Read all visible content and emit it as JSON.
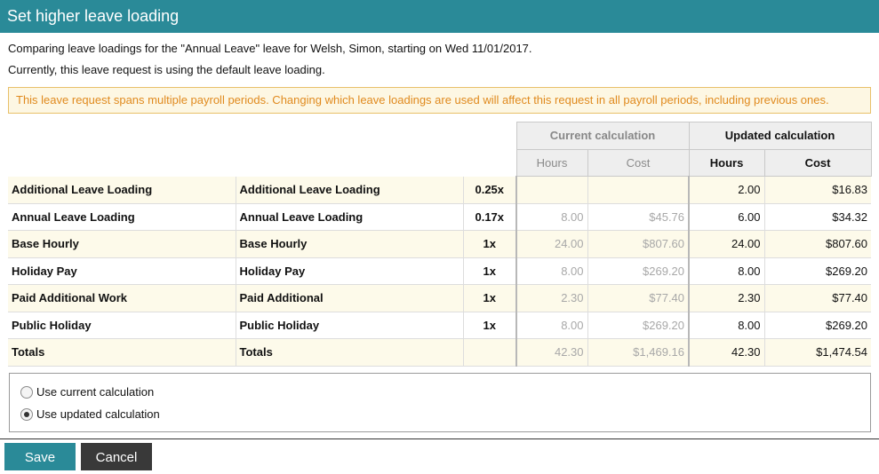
{
  "dialog": {
    "title": "Set higher leave loading",
    "intro": "Comparing leave loadings for the \"Annual Leave\" leave for Welsh, Simon, starting on Wed 11/01/2017.",
    "status": "Currently, this leave request is using the default leave loading.",
    "warning": "This leave request spans multiple payroll periods. Changing which leave loadings are used will affect this request in all payroll periods, including previous ones."
  },
  "table": {
    "current_header": "Current calculation",
    "updated_header": "Updated calculation",
    "hours_label": "Hours",
    "cost_label": "Cost",
    "rows": [
      {
        "name": "Additional Leave Loading",
        "component": "Additional Leave Loading",
        "multiplier": "0.25x",
        "cur_hours": "",
        "cur_cost": "",
        "upd_hours": "2.00",
        "upd_cost": "$16.83"
      },
      {
        "name": "Annual Leave Loading",
        "component": "Annual Leave Loading",
        "multiplier": "0.17x",
        "cur_hours": "8.00",
        "cur_cost": "$45.76",
        "upd_hours": "6.00",
        "upd_cost": "$34.32"
      },
      {
        "name": "Base Hourly",
        "component": "Base Hourly",
        "multiplier": "1x",
        "cur_hours": "24.00",
        "cur_cost": "$807.60",
        "upd_hours": "24.00",
        "upd_cost": "$807.60"
      },
      {
        "name": "Holiday Pay",
        "component": "Holiday Pay",
        "multiplier": "1x",
        "cur_hours": "8.00",
        "cur_cost": "$269.20",
        "upd_hours": "8.00",
        "upd_cost": "$269.20"
      },
      {
        "name": "Paid Additional Work",
        "component": "Paid Additional",
        "multiplier": "1x",
        "cur_hours": "2.30",
        "cur_cost": "$77.40",
        "upd_hours": "2.30",
        "upd_cost": "$77.40"
      },
      {
        "name": "Public Holiday",
        "component": "Public Holiday",
        "multiplier": "1x",
        "cur_hours": "8.00",
        "cur_cost": "$269.20",
        "upd_hours": "8.00",
        "upd_cost": "$269.20"
      },
      {
        "name": "Totals",
        "component": "Totals",
        "multiplier": "",
        "cur_hours": "42.30",
        "cur_cost": "$1,469.16",
        "upd_hours": "42.30",
        "upd_cost": "$1,474.54"
      }
    ]
  },
  "options": {
    "current_label": "Use current calculation",
    "updated_label": "Use updated calculation",
    "selected": "updated"
  },
  "buttons": {
    "save": "Save",
    "cancel": "Cancel"
  },
  "colors": {
    "accent": "#2a8a98",
    "warning_text": "#e08a1e",
    "warning_border": "#e8c069",
    "row_highlight": "#fdfaea",
    "cancel_bg": "#393939"
  }
}
